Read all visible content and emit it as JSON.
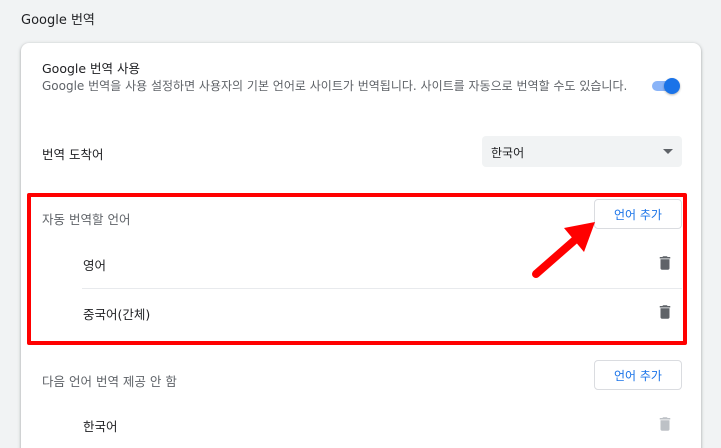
{
  "section": {
    "title": "Google 번역"
  },
  "translate_toggle": {
    "title": "Google 번역 사용",
    "description": "Google 번역을 사용 설정하면 사용자의 기본 언어로 사이트가 번역됩니다. 사이트를 자동으로 번역할 수도 있습니다.",
    "enabled": true
  },
  "target_language": {
    "label": "번역 도착어",
    "selected": "한국어"
  },
  "auto_translate": {
    "title": "자동 번역할 언어",
    "add_button": "언어 추가",
    "languages": [
      {
        "name": "영어"
      },
      {
        "name": "중국어(간체)"
      }
    ]
  },
  "never_translate": {
    "title": "다음 언어 번역 제공 안 함",
    "add_button": "언어 추가",
    "languages": [
      {
        "name": "한국어"
      }
    ]
  },
  "colors": {
    "accent": "#1a73e8",
    "toggle_track": "#8ab4f8",
    "highlight": "#ff0000",
    "trash_active": "#5f6368",
    "trash_disabled": "#bdc1c6"
  },
  "icons": {
    "trash": "trash-icon",
    "dropdown": "chevron-down-icon",
    "annotation": "arrow-icon"
  }
}
